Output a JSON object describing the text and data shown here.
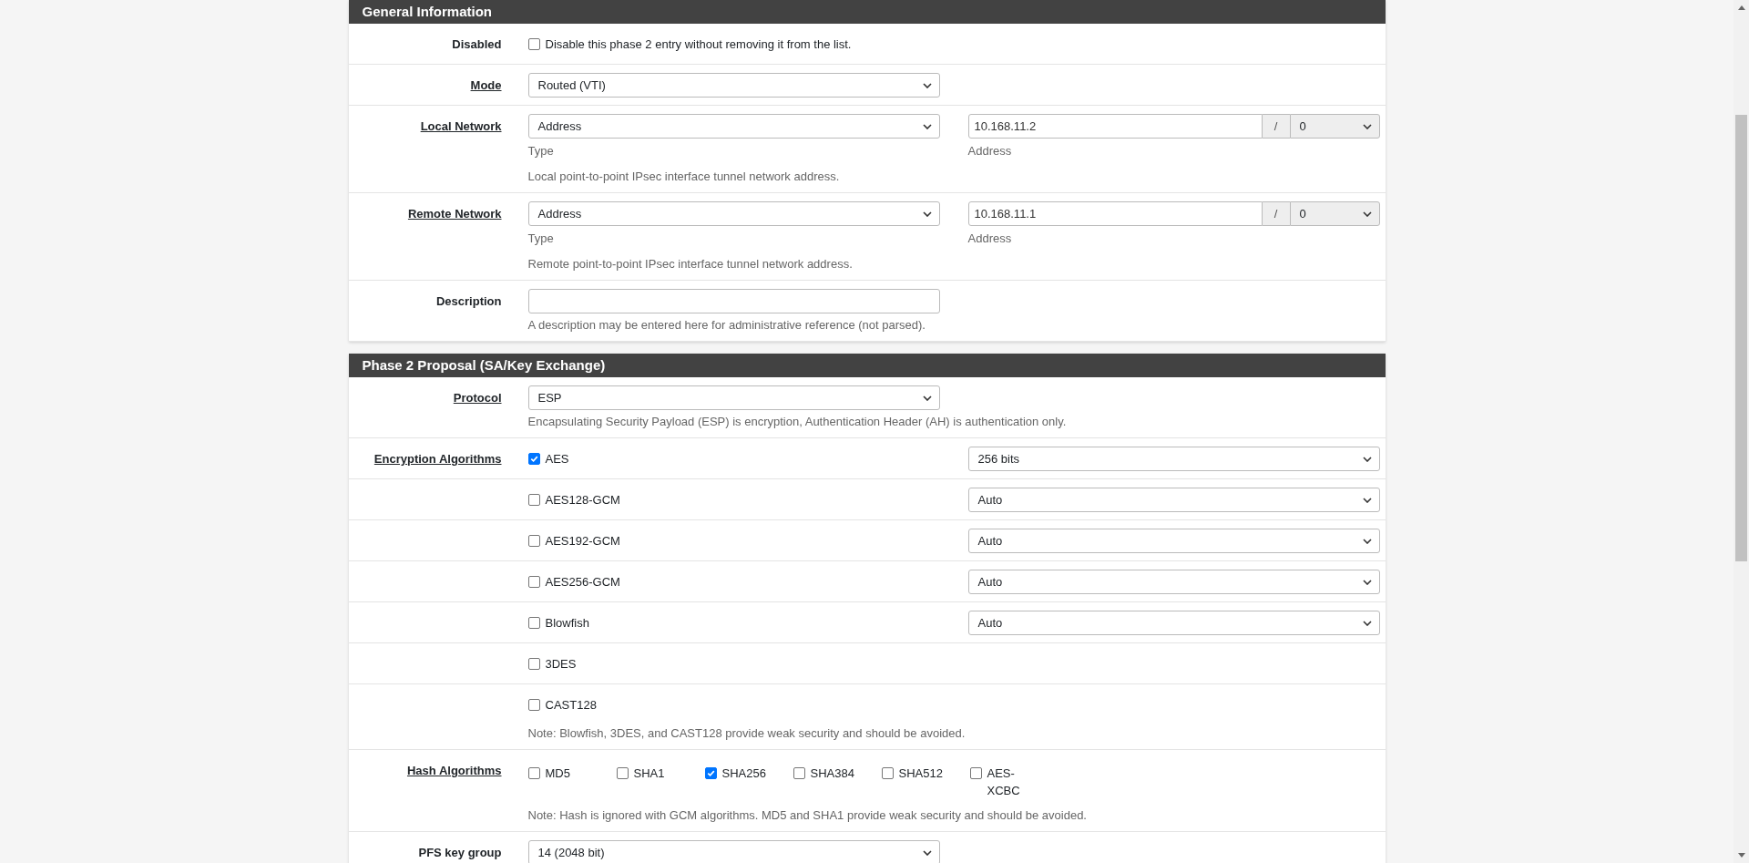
{
  "sections": [
    {
      "title": "General Information",
      "rows": [
        {
          "kind": "checkbox",
          "label": "Disabled",
          "link": false,
          "checked": false,
          "text": "Disable this phase 2 entry without removing it from the list."
        },
        {
          "kind": "select",
          "label": "Mode",
          "link": true,
          "value": "Routed (VTI)"
        },
        {
          "kind": "network",
          "label": "Local Network",
          "link": true,
          "type_value": "Address",
          "type_caption": "Type",
          "address": "10.168.11.2",
          "separator": "/",
          "mask": "0",
          "address_caption": "Address",
          "help": "Local point-to-point IPsec interface tunnel network address."
        },
        {
          "kind": "network",
          "label": "Remote Network",
          "link": true,
          "type_value": "Address",
          "type_caption": "Type",
          "address": "10.168.11.1",
          "separator": "/",
          "mask": "0",
          "address_caption": "Address",
          "help": "Remote point-to-point IPsec interface tunnel network address."
        },
        {
          "kind": "text_input",
          "label": "Description",
          "link": false,
          "help": "A description may be entered here for administrative reference (not parsed)."
        }
      ]
    },
    {
      "title": "Phase 2 Proposal (SA/Key Exchange)",
      "rows": [
        {
          "kind": "select",
          "label": "Protocol",
          "link": true,
          "value": "ESP",
          "help": "Encapsulating Security Payload (ESP) is encryption, Authentication Header (AH) is authentication only."
        },
        {
          "kind": "algorithms",
          "label": "Encryption Algorithms",
          "link": true,
          "items": [
            {
              "name": "AES",
              "checked": true,
              "key_length": "256 bits"
            },
            {
              "name": "AES128-GCM",
              "checked": false,
              "key_length": "Auto"
            },
            {
              "name": "AES192-GCM",
              "checked": false,
              "key_length": "Auto"
            },
            {
              "name": "AES256-GCM",
              "checked": false,
              "key_length": "Auto"
            },
            {
              "name": "Blowfish",
              "checked": false,
              "key_length": "Auto"
            },
            {
              "name": "3DES",
              "checked": false
            },
            {
              "name": "CAST128",
              "checked": false
            }
          ],
          "help": "Note: Blowfish, 3DES, and CAST128 provide weak security and should be avoided."
        },
        {
          "kind": "hash",
          "label": "Hash Algorithms",
          "link": true,
          "options": [
            {
              "name": "MD5",
              "checked": false
            },
            {
              "name": "SHA1",
              "checked": false
            },
            {
              "name": "SHA256",
              "checked": true
            },
            {
              "name": "SHA384",
              "checked": false
            },
            {
              "name": "SHA512",
              "checked": false
            },
            {
              "name": "AES-XCBC",
              "checked": false
            }
          ],
          "help": "Note: Hash is ignored with GCM algorithms. MD5 and SHA1 provide weak security and should be avoided."
        },
        {
          "kind": "select",
          "label": "PFS key group",
          "link": false,
          "value": "14 (2048 bit)"
        }
      ]
    }
  ]
}
